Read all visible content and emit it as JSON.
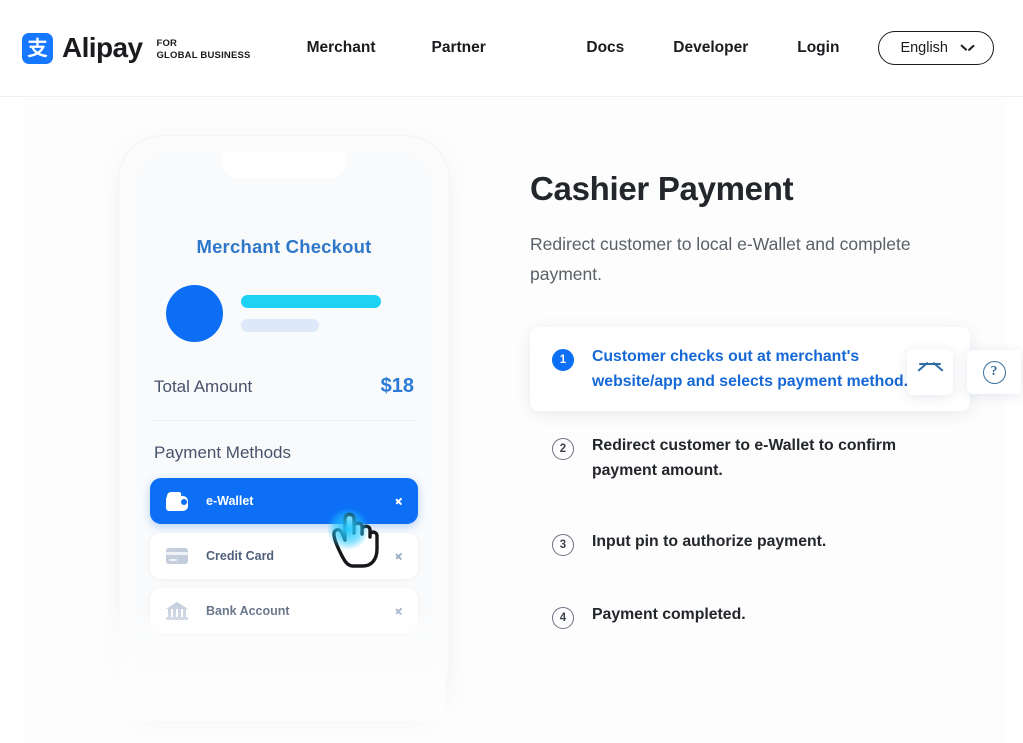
{
  "header": {
    "brand": {
      "icon": "alipay-logo-icon",
      "glyph": "支",
      "word": "Alipay",
      "sub_line1": "FOR",
      "sub_line2": "GLOBAL BUSINESS",
      "color": "#1677ff"
    },
    "nav_left": [
      {
        "label": "Merchant"
      },
      {
        "label": "Partner"
      }
    ],
    "nav_right": [
      {
        "label": "Docs"
      },
      {
        "label": "Developer"
      },
      {
        "label": "Login"
      }
    ],
    "language": {
      "label": "English",
      "icon": "chevron-down-icon"
    }
  },
  "phone": {
    "checkout_title": "Merchant Checkout",
    "total_label": "Total Amount",
    "total_value": "$18",
    "payment_methods_title": "Payment Methods",
    "methods": [
      {
        "label": "e-Wallet",
        "icon": "wallet-icon",
        "selected": true
      },
      {
        "label": "Credit Card",
        "icon": "credit-card-icon",
        "selected": false
      },
      {
        "label": "Bank Account",
        "icon": "bank-icon",
        "selected": false
      }
    ],
    "cursor": "hand-pointer-cursor"
  },
  "main": {
    "title": "Cashier Payment",
    "subtitle": "Redirect customer to local e-Wallet and complete payment.",
    "steps": [
      {
        "num": "1",
        "text": "Customer checks out at merchant's website/app and selects payment method.",
        "active": true
      },
      {
        "num": "2",
        "text": "Redirect customer to e-Wallet to confirm payment amount.",
        "active": false
      },
      {
        "num": "3",
        "text": "Input pin to authorize payment.",
        "active": false
      },
      {
        "num": "4",
        "text": "Payment completed.",
        "active": false
      }
    ]
  },
  "widgets": {
    "back_to_top": {
      "icon": "scroll-to-top-icon"
    },
    "help": {
      "icon": "question-mark-icon",
      "glyph": "?"
    }
  },
  "colors": {
    "brand_blue": "#1677ff",
    "accent_blue": "#0c6ff5",
    "step_active_text": "#1668d6",
    "cyan": "#1ed2f5",
    "text_dark": "#23262b",
    "text_muted": "#5a6068"
  }
}
